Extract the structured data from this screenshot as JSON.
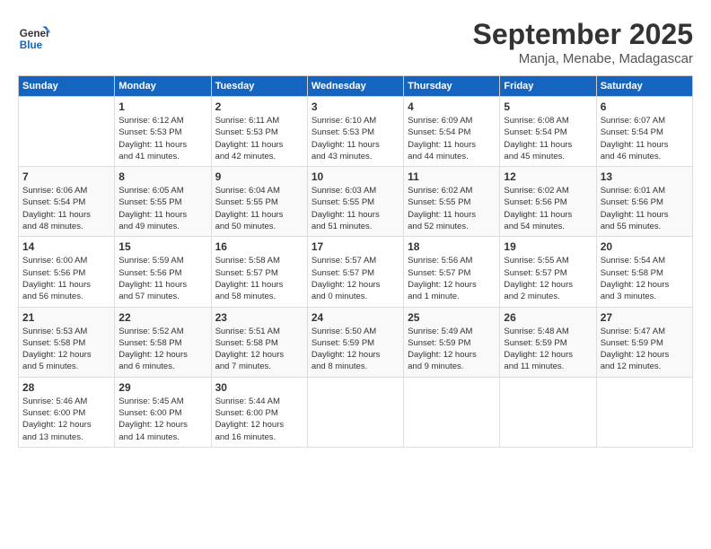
{
  "header": {
    "logo_line1": "General",
    "logo_line2": "Blue",
    "month": "September 2025",
    "location": "Manja, Menabe, Madagascar"
  },
  "days_of_week": [
    "Sunday",
    "Monday",
    "Tuesday",
    "Wednesday",
    "Thursday",
    "Friday",
    "Saturday"
  ],
  "weeks": [
    [
      {
        "num": "",
        "info": ""
      },
      {
        "num": "1",
        "info": "Sunrise: 6:12 AM\nSunset: 5:53 PM\nDaylight: 11 hours\nand 41 minutes."
      },
      {
        "num": "2",
        "info": "Sunrise: 6:11 AM\nSunset: 5:53 PM\nDaylight: 11 hours\nand 42 minutes."
      },
      {
        "num": "3",
        "info": "Sunrise: 6:10 AM\nSunset: 5:53 PM\nDaylight: 11 hours\nand 43 minutes."
      },
      {
        "num": "4",
        "info": "Sunrise: 6:09 AM\nSunset: 5:54 PM\nDaylight: 11 hours\nand 44 minutes."
      },
      {
        "num": "5",
        "info": "Sunrise: 6:08 AM\nSunset: 5:54 PM\nDaylight: 11 hours\nand 45 minutes."
      },
      {
        "num": "6",
        "info": "Sunrise: 6:07 AM\nSunset: 5:54 PM\nDaylight: 11 hours\nand 46 minutes."
      }
    ],
    [
      {
        "num": "7",
        "info": "Sunrise: 6:06 AM\nSunset: 5:54 PM\nDaylight: 11 hours\nand 48 minutes."
      },
      {
        "num": "8",
        "info": "Sunrise: 6:05 AM\nSunset: 5:55 PM\nDaylight: 11 hours\nand 49 minutes."
      },
      {
        "num": "9",
        "info": "Sunrise: 6:04 AM\nSunset: 5:55 PM\nDaylight: 11 hours\nand 50 minutes."
      },
      {
        "num": "10",
        "info": "Sunrise: 6:03 AM\nSunset: 5:55 PM\nDaylight: 11 hours\nand 51 minutes."
      },
      {
        "num": "11",
        "info": "Sunrise: 6:02 AM\nSunset: 5:55 PM\nDaylight: 11 hours\nand 52 minutes."
      },
      {
        "num": "12",
        "info": "Sunrise: 6:02 AM\nSunset: 5:56 PM\nDaylight: 11 hours\nand 54 minutes."
      },
      {
        "num": "13",
        "info": "Sunrise: 6:01 AM\nSunset: 5:56 PM\nDaylight: 11 hours\nand 55 minutes."
      }
    ],
    [
      {
        "num": "14",
        "info": "Sunrise: 6:00 AM\nSunset: 5:56 PM\nDaylight: 11 hours\nand 56 minutes."
      },
      {
        "num": "15",
        "info": "Sunrise: 5:59 AM\nSunset: 5:56 PM\nDaylight: 11 hours\nand 57 minutes."
      },
      {
        "num": "16",
        "info": "Sunrise: 5:58 AM\nSunset: 5:57 PM\nDaylight: 11 hours\nand 58 minutes."
      },
      {
        "num": "17",
        "info": "Sunrise: 5:57 AM\nSunset: 5:57 PM\nDaylight: 12 hours\nand 0 minutes."
      },
      {
        "num": "18",
        "info": "Sunrise: 5:56 AM\nSunset: 5:57 PM\nDaylight: 12 hours\nand 1 minute."
      },
      {
        "num": "19",
        "info": "Sunrise: 5:55 AM\nSunset: 5:57 PM\nDaylight: 12 hours\nand 2 minutes."
      },
      {
        "num": "20",
        "info": "Sunrise: 5:54 AM\nSunset: 5:58 PM\nDaylight: 12 hours\nand 3 minutes."
      }
    ],
    [
      {
        "num": "21",
        "info": "Sunrise: 5:53 AM\nSunset: 5:58 PM\nDaylight: 12 hours\nand 5 minutes."
      },
      {
        "num": "22",
        "info": "Sunrise: 5:52 AM\nSunset: 5:58 PM\nDaylight: 12 hours\nand 6 minutes."
      },
      {
        "num": "23",
        "info": "Sunrise: 5:51 AM\nSunset: 5:58 PM\nDaylight: 12 hours\nand 7 minutes."
      },
      {
        "num": "24",
        "info": "Sunrise: 5:50 AM\nSunset: 5:59 PM\nDaylight: 12 hours\nand 8 minutes."
      },
      {
        "num": "25",
        "info": "Sunrise: 5:49 AM\nSunset: 5:59 PM\nDaylight: 12 hours\nand 9 minutes."
      },
      {
        "num": "26",
        "info": "Sunrise: 5:48 AM\nSunset: 5:59 PM\nDaylight: 12 hours\nand 11 minutes."
      },
      {
        "num": "27",
        "info": "Sunrise: 5:47 AM\nSunset: 5:59 PM\nDaylight: 12 hours\nand 12 minutes."
      }
    ],
    [
      {
        "num": "28",
        "info": "Sunrise: 5:46 AM\nSunset: 6:00 PM\nDaylight: 12 hours\nand 13 minutes."
      },
      {
        "num": "29",
        "info": "Sunrise: 5:45 AM\nSunset: 6:00 PM\nDaylight: 12 hours\nand 14 minutes."
      },
      {
        "num": "30",
        "info": "Sunrise: 5:44 AM\nSunset: 6:00 PM\nDaylight: 12 hours\nand 16 minutes."
      },
      {
        "num": "",
        "info": ""
      },
      {
        "num": "",
        "info": ""
      },
      {
        "num": "",
        "info": ""
      },
      {
        "num": "",
        "info": ""
      }
    ]
  ]
}
